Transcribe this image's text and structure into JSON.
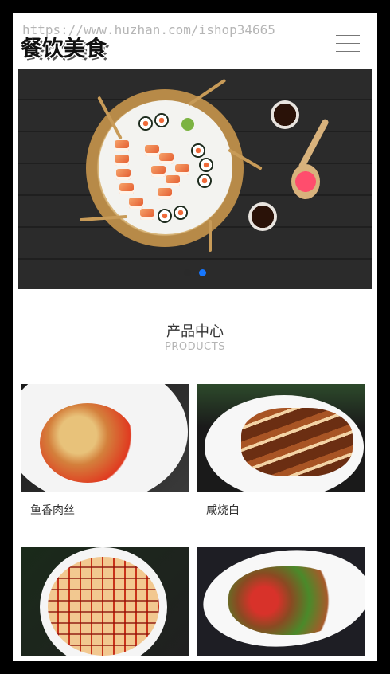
{
  "header": {
    "logo_text": "餐饮美食",
    "watermark": "https://www.huzhan.com/ishop34665",
    "menu_icon": "hamburger-menu-icon"
  },
  "banner": {
    "slides_count": 2,
    "active_slide": 2,
    "active_dot_color": "#1677ff"
  },
  "section": {
    "title_cn": "产品中心",
    "title_en": "PRODUCTS"
  },
  "products": [
    {
      "name": "鱼香肉丝"
    },
    {
      "name": "咸烧白"
    },
    {
      "name": ""
    },
    {
      "name": ""
    }
  ]
}
